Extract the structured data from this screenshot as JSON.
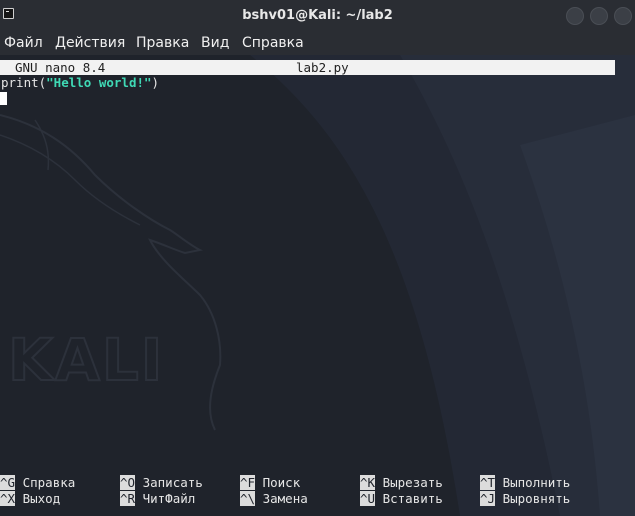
{
  "window": {
    "title": "bshv01@Kali: ~/lab2",
    "icon": "terminal-icon"
  },
  "menu": {
    "items": [
      "Файл",
      "Действия",
      "Правка",
      "Вид",
      "Справка"
    ]
  },
  "nano": {
    "version": "GNU nano 8.4",
    "filename": "lab2.py",
    "code": {
      "prefix": "print(",
      "string": "\"Hello world!\"",
      "suffix": ")"
    },
    "shortcuts": [
      {
        "key": "^G",
        "label": "Справка"
      },
      {
        "key": "^O",
        "label": "Записать"
      },
      {
        "key": "^F",
        "label": "Поиск"
      },
      {
        "key": "^K",
        "label": "Вырезать"
      },
      {
        "key": "^T",
        "label": "Выполнить"
      },
      {
        "key": "^X",
        "label": "Выход"
      },
      {
        "key": "^R",
        "label": "ЧитФайл"
      },
      {
        "key": "^\\",
        "label": "Замена"
      },
      {
        "key": "^U",
        "label": "Вставить"
      },
      {
        "key": "^J",
        "label": "Выровнять"
      }
    ]
  },
  "wallpaper": {
    "text": "KALI"
  },
  "colors": {
    "titlebar": "#2a2d33",
    "terminal_bg": "#1f232b",
    "string_accent": "#3fd9b5",
    "nano_header_bg": "#f2f2f2"
  }
}
